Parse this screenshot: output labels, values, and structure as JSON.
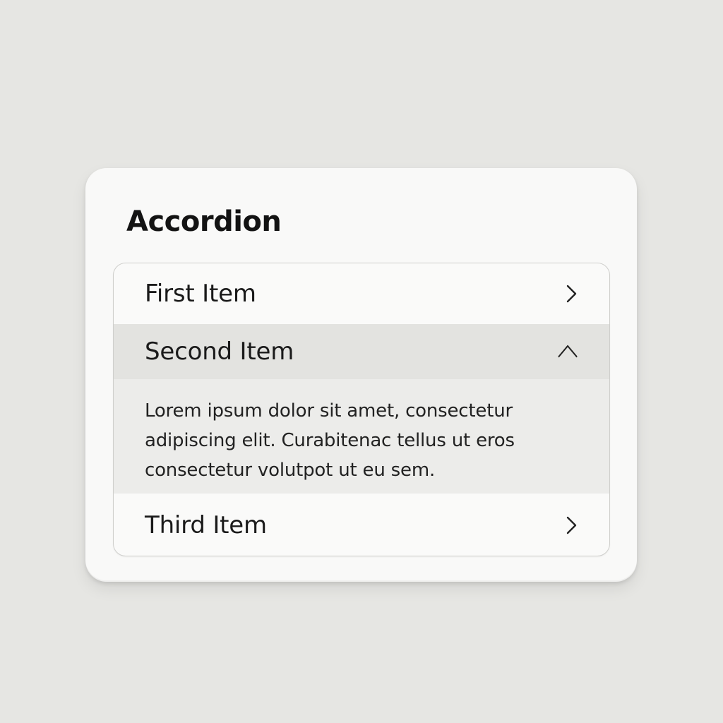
{
  "card": {
    "title": "Accordion"
  },
  "accordion": {
    "items": [
      {
        "label": "First Item",
        "expanded": false,
        "icon": "chevron-right-icon"
      },
      {
        "label": "Second Item",
        "expanded": true,
        "icon": "chevron-up-icon",
        "content": "Lorem ipsum dolor sit amet, consectetur adipiscing elit. Curabitenac tellus ut eros consectetur volutpot ut eu sem."
      },
      {
        "label": "Third Item",
        "expanded": false,
        "icon": "chevron-right-icon"
      }
    ]
  },
  "colors": {
    "background": "#e6e6e3",
    "card": "#f9f9f8",
    "expanded_header": "#e3e3e0",
    "expanded_panel": "#ececea",
    "text": "#1a1a1a"
  }
}
